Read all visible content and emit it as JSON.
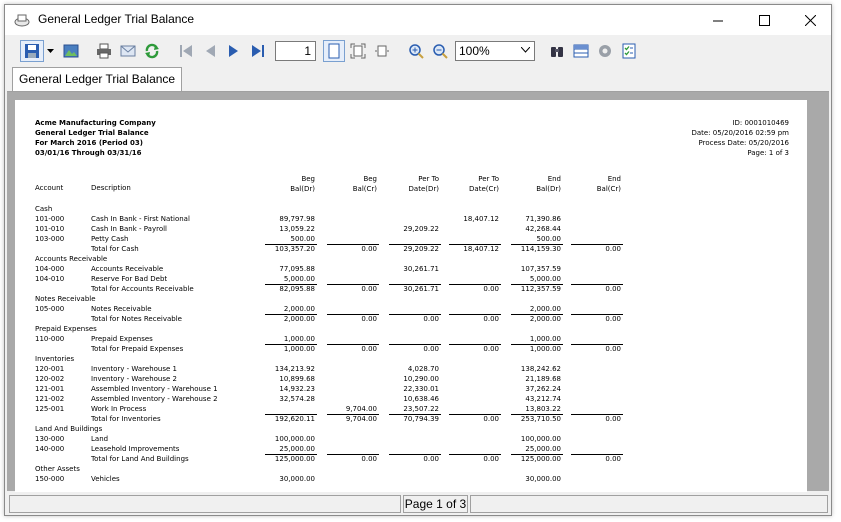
{
  "window": {
    "title": "General Ledger Trial Balance"
  },
  "toolbar": {
    "page_number": "1",
    "zoom": "100%"
  },
  "tab": {
    "label": "General Ledger Trial Balance"
  },
  "report": {
    "company": "Acme Manufacturing Company",
    "title": "General Ledger Trial Balance",
    "period": "For March 2016 (Period 03)",
    "range": "03/01/16 Through 03/31/16",
    "id_line": "ID: 0001010469",
    "date_line": "Date: 05/20/2016 02:59 pm",
    "process_date_line": "Process Date: 05/20/2016",
    "page_line": "Page: 1 of 3",
    "columns": {
      "account": "Account",
      "description": "Description",
      "beg_dr_1": "Beg",
      "beg_dr_2": "Bal(Dr)",
      "beg_cr_1": "Beg",
      "beg_cr_2": "Bal(Cr)",
      "per_to_dr_1": "Per To",
      "per_to_dr_2": "Date(Dr)",
      "per_to_cr_1": "Per To",
      "per_to_cr_2": "Date(Cr)",
      "end_dr_1": "End",
      "end_dr_2": "Bal(Dr)",
      "end_cr_1": "End",
      "end_cr_2": "Bal(Cr)"
    },
    "rows": [
      {
        "type": "group",
        "desc": "Cash"
      },
      {
        "type": "line",
        "acct": "101-000",
        "desc": "Cash In Bank - First National",
        "c1": "89,797.98",
        "c2": "",
        "c3": "",
        "c4": "18,407.12",
        "c5": "71,390.86",
        "c6": ""
      },
      {
        "type": "line",
        "acct": "101-010",
        "desc": "Cash In Bank - Payroll",
        "c1": "13,059.22",
        "c2": "",
        "c3": "29,209.22",
        "c4": "",
        "c5": "42,268.44",
        "c6": ""
      },
      {
        "type": "line",
        "acct": "103-000",
        "desc": "Petty Cash",
        "c1": "500.00",
        "c2": "",
        "c3": "",
        "c4": "",
        "c5": "500.00",
        "c6": ""
      },
      {
        "type": "total",
        "acct": "",
        "desc": "Total for Cash",
        "c1": "103,357.20",
        "c2": "0.00",
        "c3": "29,209.22",
        "c4": "18,407.12",
        "c5": "114,159.30",
        "c6": "0.00"
      },
      {
        "type": "group",
        "desc": "Accounts Receivable"
      },
      {
        "type": "line",
        "acct": "104-000",
        "desc": "Accounts Receivable",
        "c1": "77,095.88",
        "c2": "",
        "c3": "30,261.71",
        "c4": "",
        "c5": "107,357.59",
        "c6": ""
      },
      {
        "type": "line",
        "acct": "104-010",
        "desc": "Reserve For Bad Debt",
        "c1": "5,000.00",
        "c2": "",
        "c3": "",
        "c4": "",
        "c5": "5,000.00",
        "c6": ""
      },
      {
        "type": "total",
        "acct": "",
        "desc": "Total for Accounts Receivable",
        "c1": "82,095.88",
        "c2": "0.00",
        "c3": "30,261.71",
        "c4": "0.00",
        "c5": "112,357.59",
        "c6": "0.00"
      },
      {
        "type": "group",
        "desc": "Notes Receivable"
      },
      {
        "type": "line",
        "acct": "105-000",
        "desc": "Notes Receivable",
        "c1": "2,000.00",
        "c2": "",
        "c3": "",
        "c4": "",
        "c5": "2,000.00",
        "c6": ""
      },
      {
        "type": "total",
        "acct": "",
        "desc": "Total for Notes Receivable",
        "c1": "2,000.00",
        "c2": "0.00",
        "c3": "0.00",
        "c4": "0.00",
        "c5": "2,000.00",
        "c6": "0.00"
      },
      {
        "type": "group",
        "desc": "Prepaid Expenses"
      },
      {
        "type": "line",
        "acct": "110-000",
        "desc": "Prepaid Expenses",
        "c1": "1,000.00",
        "c2": "",
        "c3": "",
        "c4": "",
        "c5": "1,000.00",
        "c6": ""
      },
      {
        "type": "total",
        "acct": "",
        "desc": "Total for Prepaid Expenses",
        "c1": "1,000.00",
        "c2": "0.00",
        "c3": "0.00",
        "c4": "0.00",
        "c5": "1,000.00",
        "c6": "0.00"
      },
      {
        "type": "group",
        "desc": "Inventories"
      },
      {
        "type": "line",
        "acct": "120-001",
        "desc": "Inventory - Warehouse 1",
        "c1": "134,213.92",
        "c2": "",
        "c3": "4,028.70",
        "c4": "",
        "c5": "138,242.62",
        "c6": ""
      },
      {
        "type": "line",
        "acct": "120-002",
        "desc": "Inventory - Warehouse 2",
        "c1": "10,899.68",
        "c2": "",
        "c3": "10,290.00",
        "c4": "",
        "c5": "21,189.68",
        "c6": ""
      },
      {
        "type": "line",
        "acct": "121-001",
        "desc": "Assembled Inventory - Warehouse 1",
        "c1": "14,932.23",
        "c2": "",
        "c3": "22,330.01",
        "c4": "",
        "c5": "37,262.24",
        "c6": ""
      },
      {
        "type": "line",
        "acct": "121-002",
        "desc": "Assembled Inventory - Warehouse 2",
        "c1": "32,574.28",
        "c2": "",
        "c3": "10,638.46",
        "c4": "",
        "c5": "43,212.74",
        "c6": ""
      },
      {
        "type": "line",
        "acct": "125-001",
        "desc": "Work In Process",
        "c1": "",
        "c2": "9,704.00",
        "c3": "23,507.22",
        "c4": "",
        "c5": "13,803.22",
        "c6": ""
      },
      {
        "type": "total",
        "acct": "",
        "desc": "Total for Inventories",
        "c1": "192,620.11",
        "c2": "9,704.00",
        "c3": "70,794.39",
        "c4": "0.00",
        "c5": "253,710.50",
        "c6": "0.00"
      },
      {
        "type": "group",
        "desc": "Land And Buildings"
      },
      {
        "type": "line",
        "acct": "130-000",
        "desc": "Land",
        "c1": "100,000.00",
        "c2": "",
        "c3": "",
        "c4": "",
        "c5": "100,000.00",
        "c6": ""
      },
      {
        "type": "line",
        "acct": "140-000",
        "desc": "Leasehold Improvements",
        "c1": "25,000.00",
        "c2": "",
        "c3": "",
        "c4": "",
        "c5": "25,000.00",
        "c6": ""
      },
      {
        "type": "total",
        "acct": "",
        "desc": "Total for Land And Buildings",
        "c1": "125,000.00",
        "c2": "0.00",
        "c3": "0.00",
        "c4": "0.00",
        "c5": "125,000.00",
        "c6": "0.00"
      },
      {
        "type": "group",
        "desc": "Other Assets"
      },
      {
        "type": "line",
        "acct": "150-000",
        "desc": "Vehicles",
        "c1": "30,000.00",
        "c2": "",
        "c3": "",
        "c4": "",
        "c5": "30,000.00",
        "c6": ""
      }
    ]
  },
  "status": {
    "page_text": "Page 1 of 3"
  }
}
